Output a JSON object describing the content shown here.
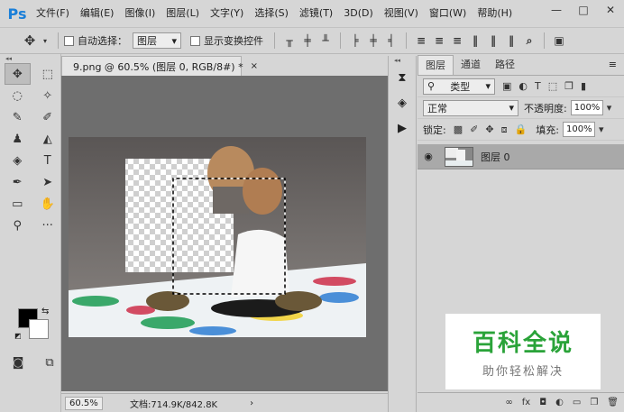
{
  "app": {
    "logo": "Ps"
  },
  "menu": [
    "文件(F)",
    "编辑(E)",
    "图像(I)",
    "图层(L)",
    "文字(Y)",
    "选择(S)",
    "滤镜(T)",
    "3D(D)",
    "视图(V)",
    "窗口(W)",
    "帮助(H)"
  ],
  "window_controls": {
    "minimize": "—",
    "maximize": "□",
    "close": "✕"
  },
  "options": {
    "auto_select_label": "自动选择：",
    "auto_select_value": "图层",
    "show_transform_label": "显示变换控件"
  },
  "document": {
    "tab_title": "9.png @ 60.5% (图层 0, RGB/8#) *",
    "tab_close": "×",
    "zoom": "60.5%",
    "info": "文档:714.9K/842.8K",
    "status_arrow": "›"
  },
  "layers_panel": {
    "tabs": [
      "图层",
      "通道",
      "路径"
    ],
    "menu_icon": "≡",
    "filter_label": "类型",
    "blend_mode": "正常",
    "opacity_label": "不透明度:",
    "opacity_value": "100%",
    "lock_label": "锁定:",
    "fill_label": "填充:",
    "fill_value": "100%",
    "layers": [
      {
        "name": "图层 0"
      }
    ],
    "bottom_icons": [
      "∞",
      "fx",
      "◘",
      "◐",
      "▭",
      "❐",
      "🗑"
    ]
  },
  "watermark": {
    "title": "百科全说",
    "subtitle": "助你轻松解决"
  },
  "colors": {
    "foreground": "#000000",
    "background": "#ffffff",
    "accent": "#1b7fd8",
    "watermark": "#2aa339"
  }
}
